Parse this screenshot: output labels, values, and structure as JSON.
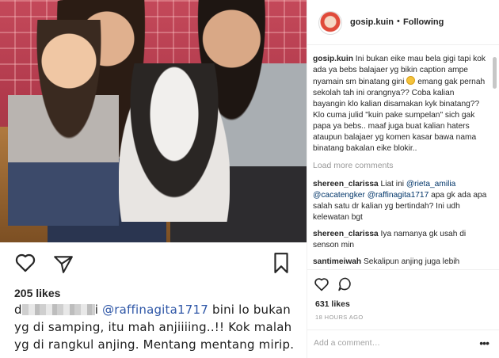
{
  "post": {
    "likes_left": "205 likes",
    "hand_caption": {
      "prefix": "d",
      "suffix": "i",
      "mention": "@raffinagita1717",
      "text_1": " bini lo bukan yg di samping, itu mah anjiiiing..!! Kok malah yg di rangkul anjing. Mentang mentang mirip."
    }
  },
  "header": {
    "username": "gosip.kuin",
    "separator": "•",
    "follow_status": "Following"
  },
  "caption": {
    "username": "gosip.kuin",
    "text_a": "Ini bukan eike mau bela gigi tapi kok ada ya bebs balajaer yg bikin caption ampe nyamain sm binatang gini",
    "emoji": "grinning-sweat-emoji",
    "text_b": "emang gak pernah sekolah tah ini orangnya?? Coba kalian bayangin klo kalian disamakan kyk binatang?? Klo cuma julid \"kuin pake sumpelan\" sich gak papa ya bebs.. maaf juga buat kalian haters ataupun balajaer yg komen kasar bawa nama binatang bakalan eike blokir.."
  },
  "load_more": "Load more comments",
  "comments": [
    {
      "user": "shereen_clarissa",
      "pre": "Liat ini",
      "mentions": [
        "@rieta_amilia",
        "@cacatengker",
        "@raffinagita1717"
      ],
      "post": "apa gk ada apa salah satu dr kalian yg bertindah? Ini udh kelewatan bgt"
    },
    {
      "user": "shereen_clarissa",
      "text": "Iya namanya gk usah di senson min"
    },
    {
      "user": "santimeiwah",
      "text": "Sekalipun anjing juga lebih"
    }
  ],
  "actions": {
    "likes_right": "631 likes",
    "time": "18 HOURS AGO",
    "add_comment_placeholder": "Add a comment…",
    "more": "•••"
  },
  "colors": {
    "text": "#262626",
    "muted": "#999999",
    "link": "#003569",
    "border": "#efefef"
  }
}
